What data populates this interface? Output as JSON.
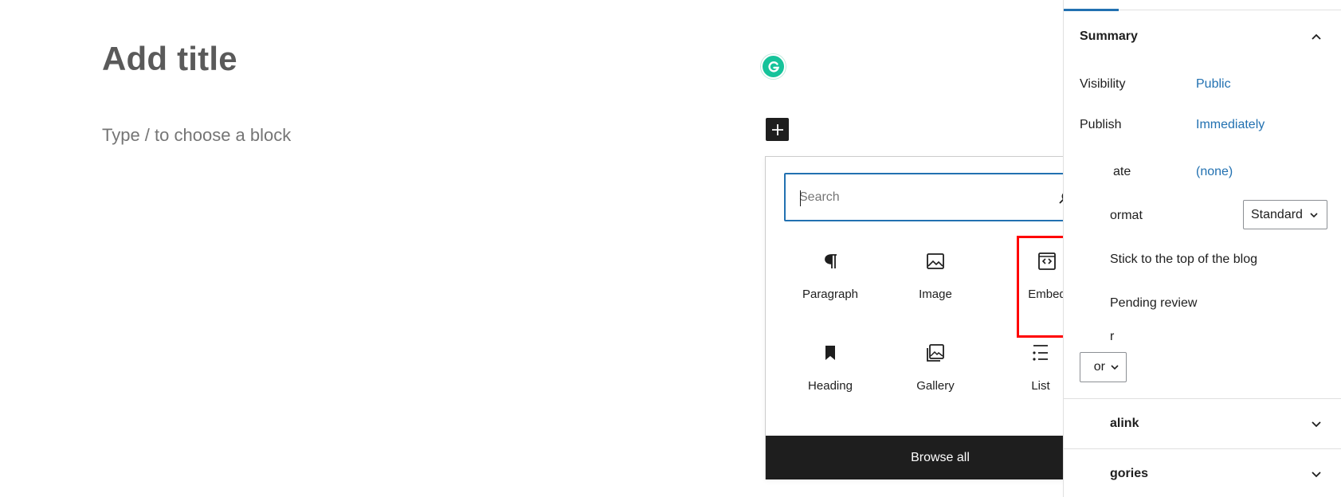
{
  "editor": {
    "title_placeholder": "Add title",
    "block_placeholder": "Type / to choose a block",
    "grammarly_icon": "grammarly-icon",
    "add_block_icon": "plus-icon"
  },
  "inserter": {
    "search_placeholder": "Search",
    "search_icon": "search-icon",
    "blocks": [
      {
        "label": "Paragraph",
        "icon": "paragraph-icon"
      },
      {
        "label": "Image",
        "icon": "image-icon"
      },
      {
        "label": "Embed",
        "icon": "embed-icon"
      },
      {
        "label": "Heading",
        "icon": "bookmark-icon"
      },
      {
        "label": "Gallery",
        "icon": "gallery-icon"
      },
      {
        "label": "List",
        "icon": "list-icon"
      }
    ],
    "browse_all": "Browse all"
  },
  "sidebar": {
    "summary_title": "Summary",
    "visibility_label": "Visibility",
    "visibility_value": "Public",
    "publish_label": "Publish",
    "publish_value": "Immediately",
    "template_label": "ate",
    "template_value": "(none)",
    "format_label": "ormat",
    "format_value": "Standard",
    "sticky_label": "Stick to the top of the blog",
    "pending_label": "Pending review",
    "author_label": "r",
    "author_value": "or",
    "permalink_title": "alink",
    "categories_title": "gories"
  },
  "colors": {
    "accent": "#2271b1",
    "grammarly": "#15c39a",
    "highlight": "#ff0000",
    "dark": "#1e1e1e"
  }
}
